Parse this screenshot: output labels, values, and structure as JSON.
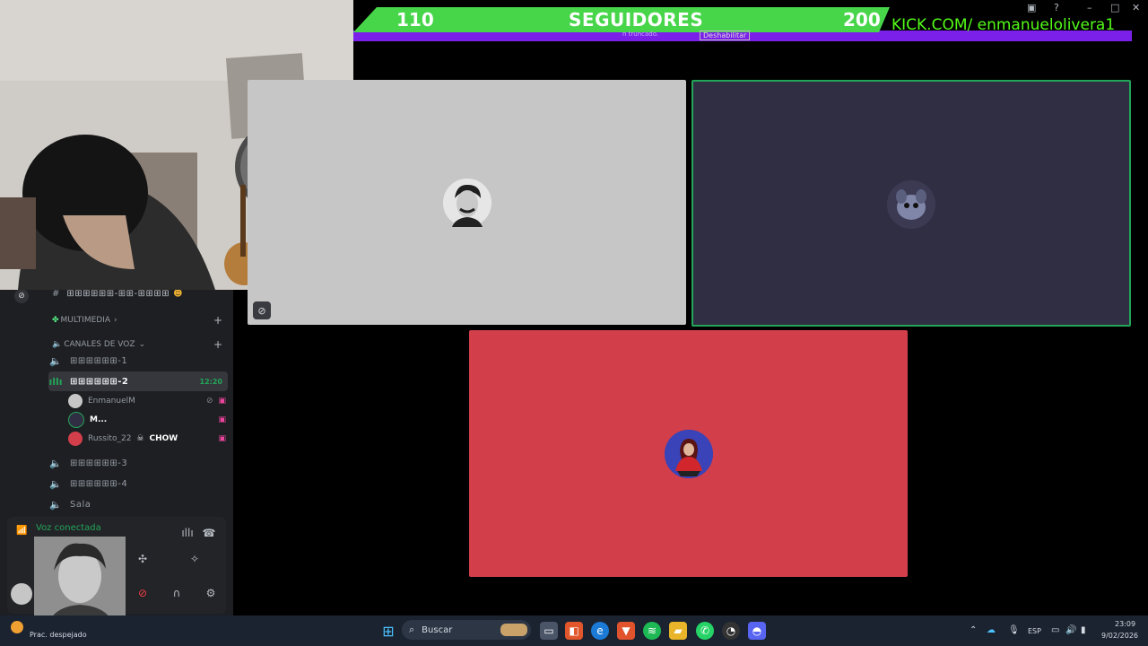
{
  "overlay": {
    "follower_current": "110",
    "follower_title": "SEGUIDORES",
    "follower_goal": "200",
    "kick_text": "KICK.COM/ enmanueloliverа1",
    "truncated_note": "n truncado.",
    "disable_label": "Deshabilitar"
  },
  "sidebar": {
    "top_channel": "⊞⊞⊞⊞⊞⊞-⊞⊞-⊞⊞⊞⊞",
    "categories": [
      {
        "label": "MULTIMEDIA"
      },
      {
        "label": "CANALES DE VOZ"
      }
    ],
    "voice_channels": [
      {
        "label": "⊞⊞⊞⊞⊞⊞-1"
      },
      {
        "label": "⊞⊞⊞⊞⊞⊞-2",
        "time": "12:20"
      },
      {
        "label": "⊞⊞⊞⊞⊞⊞-3"
      },
      {
        "label": "⊞⊞⊞⊞⊞⊞-4"
      },
      {
        "label": "Sala"
      }
    ],
    "members": [
      {
        "name": "EnmanuelM"
      },
      {
        "name": "M..."
      },
      {
        "name": "Russito_22",
        "status": "CHOW"
      }
    ]
  },
  "voice_panel": {
    "title": "Voz conectada"
  },
  "taskbar": {
    "search_placeholder": "Buscar",
    "weather": "Prac. despejado",
    "lang": "ESP",
    "time": "23:09",
    "date": "9/02/2026"
  },
  "colors": {
    "green_accent": "#23a559",
    "banner_green": "#47d54a",
    "banner_purple": "#7a20e8",
    "kick_green": "#53fc18",
    "tile_red": "#d23f4b",
    "tile_dark": "#302e42"
  }
}
